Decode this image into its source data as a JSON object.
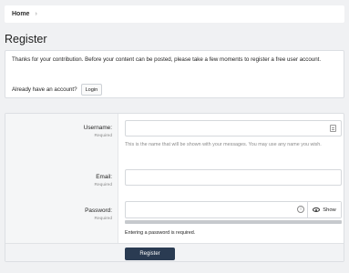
{
  "breadcrumb": {
    "home": "Home",
    "separator": "›"
  },
  "page": {
    "title": "Register"
  },
  "notice": {
    "text": "Thanks for your contribution. Before your content can be posted, please take a few moments to register a free user account.",
    "login_prompt": "Already have an account?",
    "login_button": "Login"
  },
  "form": {
    "username": {
      "label": "Username:",
      "hint": "Required",
      "value": "",
      "explain": "This is the name that will be shown with your messages. You may use any name you wish."
    },
    "email": {
      "label": "Email:",
      "hint": "Required",
      "value": ""
    },
    "password": {
      "label": "Password:",
      "hint": "Required",
      "value": "",
      "show_label": "Show",
      "message": "Entering a password is required."
    },
    "submit_label": "Register"
  },
  "icons": {
    "username_field": "id-card-icon",
    "password_info": "info-icon",
    "show_password": "eye-icon"
  }
}
